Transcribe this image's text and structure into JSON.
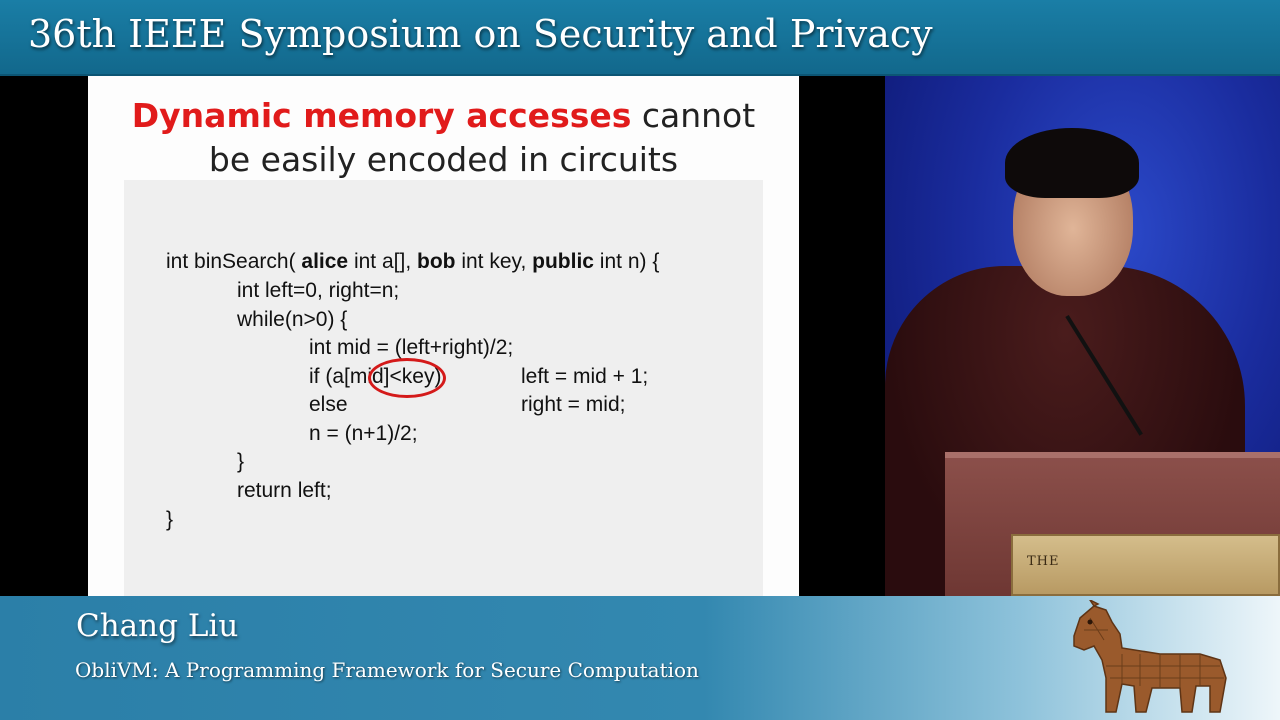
{
  "header": {
    "title": "36th IEEE Symposium on Security and Privacy"
  },
  "slide": {
    "title_highlight": "Dynamic memory accesses",
    "title_rest_1": " cannot",
    "title_line_2": "be easily encoded in circuits",
    "code": {
      "l1_a": "int binSearch( ",
      "l1_b": "alice",
      "l1_c": " int a[], ",
      "l1_d": "bob",
      "l1_e": " int key, ",
      "l1_f": "public",
      "l1_g": " int n) {",
      "l2": "int left=0, right=n;",
      "l3": "while(n>0) {",
      "l4": "int mid = (left+right)/2;",
      "l5_a": "if (a[mid]<key)",
      "l5_b": "left = mid + 1;",
      "l6_a": "else",
      "l6_b": "right = mid;",
      "l7": "n = (n+1)/2;",
      "l8": "}",
      "l9": "return left;",
      "l10": "}"
    }
  },
  "video": {
    "plaque_text": "THE"
  },
  "lower_third": {
    "speaker": "Chang Liu",
    "talk": "ObliVM: A Programming Framework for Secure Computation"
  },
  "colors": {
    "bar": "#1a7ea6",
    "highlight": "#e11b1b"
  },
  "icons": {
    "logo": "wooden-trojan-horse-icon"
  }
}
